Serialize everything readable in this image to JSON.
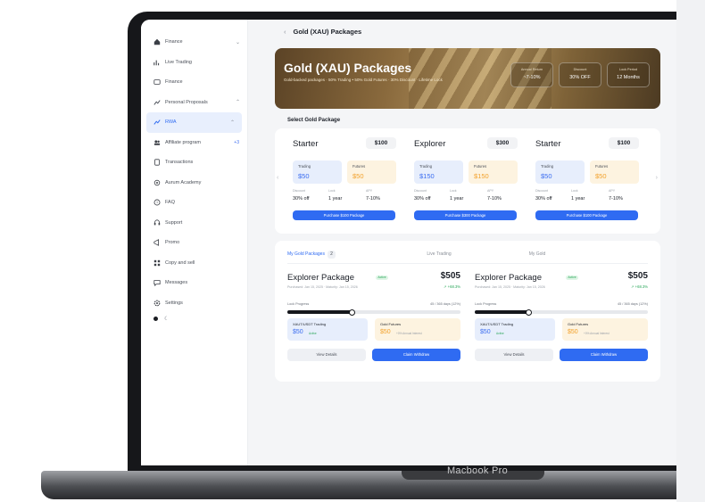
{
  "device": {
    "label": "Macbook Pro"
  },
  "sidebar": {
    "items": [
      {
        "label": "Finance",
        "icon": "home-icon",
        "chev": "⌄"
      },
      {
        "label": "Live Trading",
        "icon": "chart-icon"
      },
      {
        "label": "Finance",
        "icon": "folder-icon"
      },
      {
        "label": "Personal Proposals",
        "icon": "trend-icon",
        "chev": "⌃"
      },
      {
        "label": "RWA",
        "icon": "trend-icon",
        "chev": "⌃",
        "active": true
      },
      {
        "label": "Affiliate program",
        "icon": "users-icon",
        "badge": "+3"
      },
      {
        "label": "Transactions",
        "icon": "document-icon"
      },
      {
        "label": "Aurum Academy",
        "icon": "academy-icon"
      },
      {
        "label": "FAQ",
        "icon": "help-icon"
      },
      {
        "label": "Support",
        "icon": "support-icon"
      },
      {
        "label": "Promo",
        "icon": "promo-icon"
      },
      {
        "label": "Copy and sell",
        "icon": "grid-icon"
      },
      {
        "label": "Messages",
        "icon": "message-icon"
      },
      {
        "label": "Settings",
        "icon": "gear-icon"
      }
    ]
  },
  "topbar": {
    "back": "‹",
    "title": "Gold (XAU) Packages"
  },
  "hero": {
    "title": "Gold (XAU) Packages",
    "subtitle": "Gold-backed packages · 50% Trading • 50% Gold Futures · 30% Discount · Lifetime Lock",
    "stats": [
      {
        "label": "Annual Return",
        "value": "~7-10%"
      },
      {
        "label": "Discount",
        "value": "30% OFF"
      },
      {
        "label": "Lock Period",
        "value": "12 Months"
      }
    ]
  },
  "select_title": "Select Gold Package",
  "nav": {
    "prev": "‹",
    "next": "›"
  },
  "packages": [
    {
      "name": "Starter",
      "price": "$100",
      "trading_label": "Trading",
      "trading": "$50",
      "futures_label": "Futures",
      "futures": "$50",
      "m1_label": "Discount",
      "m1": "30% off",
      "m2_label": "Lock",
      "m2": "1 year",
      "m3_label": "APY",
      "m3": "7-10%",
      "button": "Purchase $100 Package"
    },
    {
      "name": "Explorer",
      "price": "$300",
      "trading_label": "Trading",
      "trading": "$150",
      "futures_label": "Futures",
      "futures": "$150",
      "m1_label": "Discount",
      "m1": "30% off",
      "m2_label": "Lock",
      "m2": "1 year",
      "m3_label": "APY",
      "m3": "7-10%",
      "button": "Purchase $300 Package"
    },
    {
      "name": "Starter",
      "price": "$100",
      "trading_label": "Trading",
      "trading": "$50",
      "futures_label": "Futures",
      "futures": "$50",
      "m1_label": "Discount",
      "m1": "30% off",
      "m2_label": "Lock",
      "m2": "1 year",
      "m3_label": "APY",
      "m3": "7-10%",
      "button": "Purchase $100 Package"
    }
  ],
  "orders": {
    "tabs": [
      {
        "label": "My Gold Packages",
        "count": "2",
        "active": true
      },
      {
        "label": "Live Trading"
      },
      {
        "label": "My Gold"
      }
    ],
    "cards": [
      {
        "name": "Explorer Package",
        "status": "Active",
        "value": "$505",
        "change": "↗ +68.3%",
        "dates": "Purchased: Jan 15, 2025 · Maturity: Jan 15, 2026",
        "progress_label": "Lock Progress",
        "progress_text": "45 / 365 days (12%)",
        "progress": 0.37,
        "trading_label": "XAUT/USDT Trading",
        "trading_value": "$50",
        "trading_sub": "Active",
        "futures_label": "Gold Futures",
        "futures_value": "$50",
        "futures_sub": "+0% Annual Interest",
        "btn_details": "View Details",
        "btn_withdraw": "Claim Withdraw"
      },
      {
        "name": "Explorer Package",
        "status": "Active",
        "value": "$505",
        "change": "↗ +68.3%",
        "dates": "Purchased: Jan 15, 2025 · Maturity: Jan 15, 2026",
        "progress_label": "Lock Progress",
        "progress_text": "45 / 365 days (12%)",
        "progress": 0.31,
        "trading_label": "XAUT/USDT Trading",
        "trading_value": "$50",
        "trading_sub": "Active",
        "futures_label": "Gold Futures",
        "futures_value": "$50",
        "futures_sub": "+0% Annual Interest",
        "btn_details": "View Details",
        "btn_withdraw": "Claim Withdraw"
      }
    ]
  },
  "colors": {
    "accent": "#2f6bf2",
    "trading": "#3b6df0",
    "futures": "#f2a12b",
    "positive": "#2aa75a"
  }
}
